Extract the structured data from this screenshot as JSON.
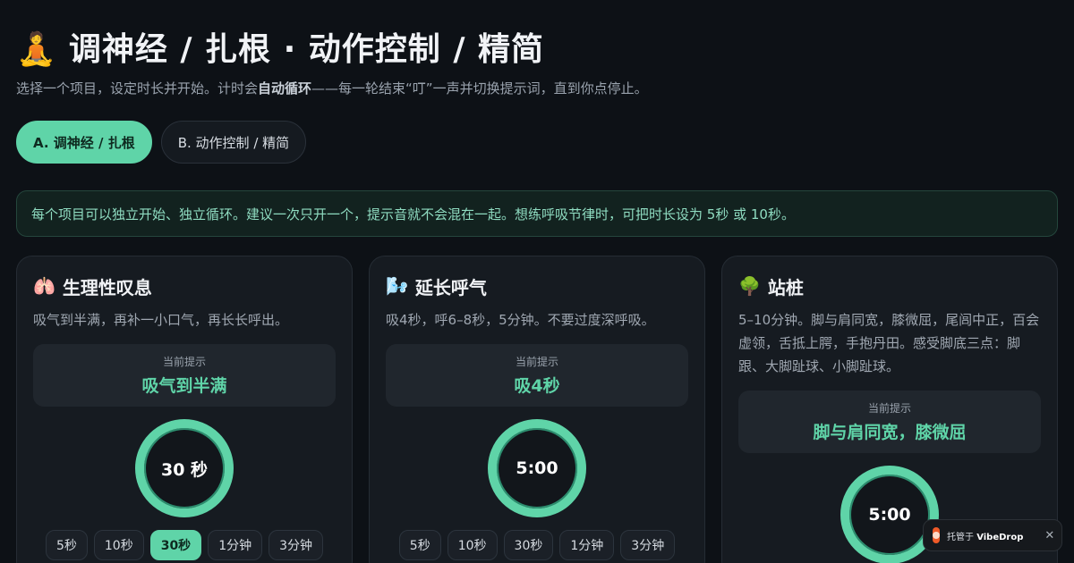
{
  "header": {
    "emoji": "🧘",
    "title": "调神经 / 扎根 · 动作控制 / 精简",
    "subtitle_pre": "选择一个项目，设定时长并开始。计时会",
    "subtitle_bold": "自动循环",
    "subtitle_post": "——每一轮结束“叮”一声并切换提示词，直到你点停止。"
  },
  "tabs": [
    {
      "label": "A. 调神经 / 扎根",
      "active": true
    },
    {
      "label": "B. 动作控制 / 精简",
      "active": false
    }
  ],
  "notice": "每个项目可以独立开始、独立循环。建议一次只开一个，提示音就不会混在一起。想练呼吸节律时，可把时长设为 5秒 或 10秒。",
  "cards": [
    {
      "emoji": "🫁",
      "title": "生理性叹息",
      "desc": "吸气到半满，再补一小口气，再长长呼出。",
      "prompt_label": "当前提示",
      "prompt": "吸气到半满",
      "timer": "30 秒",
      "durations": [
        "5秒",
        "10秒",
        "30秒",
        "1分钟",
        "3分钟"
      ],
      "active_duration": "30秒"
    },
    {
      "emoji": "🌬️",
      "title": "延长呼气",
      "desc": "吸4秒，呼6–8秒，5分钟。不要过度深呼吸。",
      "prompt_label": "当前提示",
      "prompt": "吸4秒",
      "timer": "5:00",
      "durations": [
        "5秒",
        "10秒",
        "30秒",
        "1分钟",
        "3分钟"
      ],
      "active_duration": ""
    },
    {
      "emoji": "🌳",
      "title": "站桩",
      "desc": "5–10分钟。脚与肩同宽，膝微屈，尾闾中正，百会虚领，舌抵上腭，手抱丹田。感受脚底三点：脚跟、大脚趾球、小脚趾球。",
      "prompt_label": "当前提示",
      "prompt": "脚与肩同宽，膝微屈",
      "timer": "5:00",
      "durations": [],
      "active_duration": ""
    }
  ],
  "vibedrop": {
    "prefix": "托管于",
    "brand": "VibeDrop",
    "close": "✕"
  }
}
